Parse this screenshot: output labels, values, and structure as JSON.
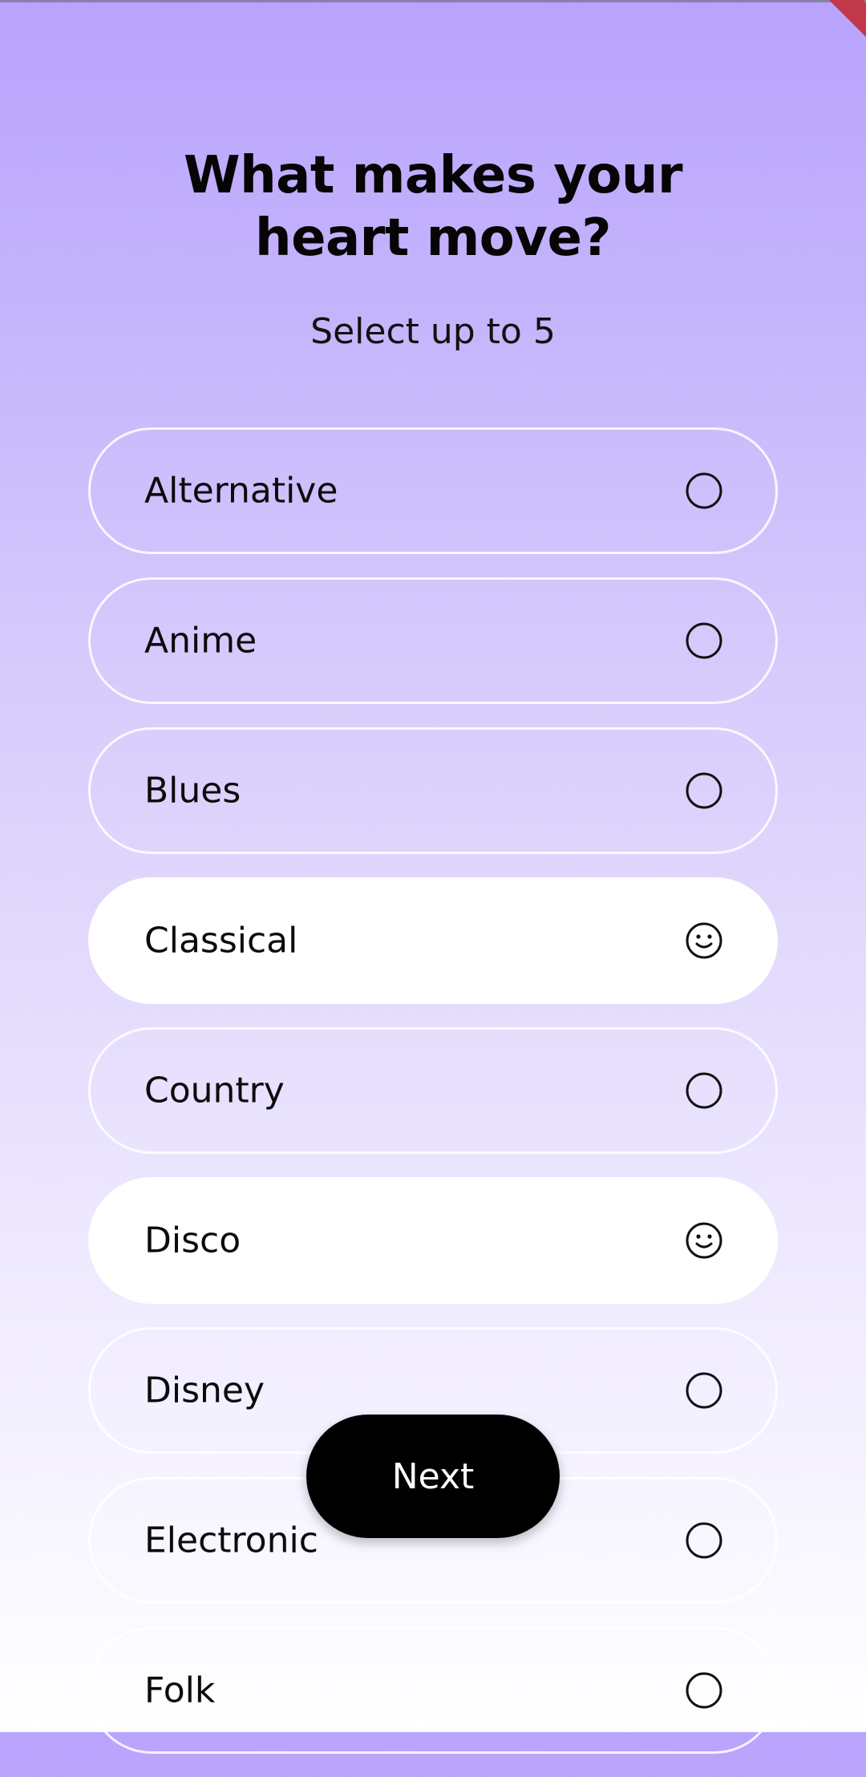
{
  "header": {
    "title_line1": "What makes your",
    "title_line2": "heart move?",
    "subtitle": "Select up to 5"
  },
  "genres": [
    {
      "label": "Alternative",
      "selected": false,
      "icon": "circle-icon"
    },
    {
      "label": "Anime",
      "selected": false,
      "icon": "circle-icon"
    },
    {
      "label": "Blues",
      "selected": false,
      "icon": "circle-icon"
    },
    {
      "label": "Classical",
      "selected": true,
      "icon": "smiley-icon"
    },
    {
      "label": "Country",
      "selected": false,
      "icon": "circle-icon"
    },
    {
      "label": "Disco",
      "selected": true,
      "icon": "smiley-icon"
    },
    {
      "label": "Disney",
      "selected": false,
      "icon": "circle-icon"
    },
    {
      "label": "Electronic",
      "selected": false,
      "icon": "circle-icon"
    },
    {
      "label": "Folk",
      "selected": false,
      "icon": "circle-icon"
    }
  ],
  "actions": {
    "next_label": "Next"
  },
  "colors": {
    "gradient_top": "#b9a3fd",
    "gradient_bottom": "#ffffff",
    "selected_bg": "#ffffff",
    "button_bg": "#000000",
    "button_text": "#ffffff"
  }
}
